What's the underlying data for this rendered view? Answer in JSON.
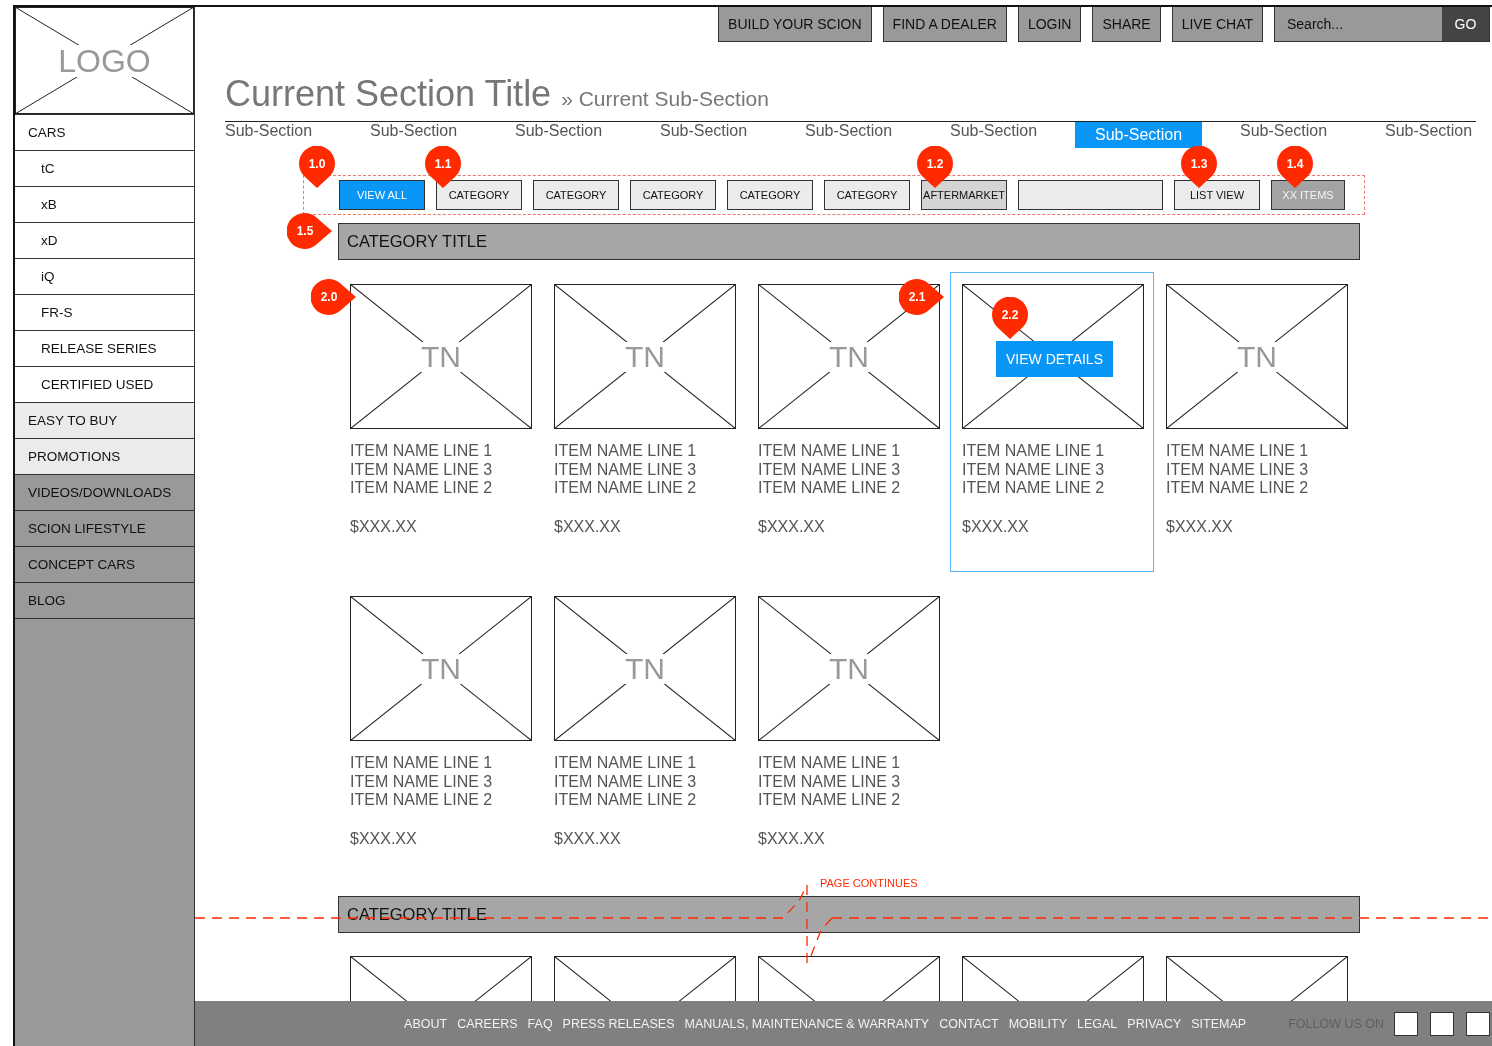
{
  "logo": {
    "text": "LOGO"
  },
  "sidebar": {
    "items": [
      {
        "label": "CARS",
        "kind": "header"
      },
      {
        "label": "tC",
        "kind": "sub"
      },
      {
        "label": "xB",
        "kind": "sub"
      },
      {
        "label": "xD",
        "kind": "sub"
      },
      {
        "label": "iQ",
        "kind": "sub"
      },
      {
        "label": "FR-S",
        "kind": "sub"
      },
      {
        "label": "RELEASE SERIES",
        "kind": "sub"
      },
      {
        "label": "CERTIFIED USED",
        "kind": "sub"
      },
      {
        "label": "EASY TO BUY",
        "kind": "light"
      },
      {
        "label": "PROMOTIONS",
        "kind": "light"
      },
      {
        "label": "VIDEOS/DOWNLOADS",
        "kind": "dark"
      },
      {
        "label": "SCION LIFESTYLE",
        "kind": "dark"
      },
      {
        "label": "CONCEPT CARS",
        "kind": "dark"
      },
      {
        "label": "BLOG",
        "kind": "dark"
      }
    ]
  },
  "top_nav": {
    "buttons": [
      "BUILD YOUR SCION",
      "FIND A DEALER",
      "LOGIN",
      "SHARE",
      "LIVE CHAT"
    ],
    "search": {
      "placeholder": "Search...",
      "button": "GO"
    }
  },
  "page_title": {
    "title": "Current Section Title",
    "subtitle": "» Current Sub-Section"
  },
  "subsection_tabs": [
    {
      "label": "Sub-Section",
      "selected": false
    },
    {
      "label": "Sub-Section",
      "selected": false
    },
    {
      "label": "Sub-Section",
      "selected": false
    },
    {
      "label": "Sub-Section",
      "selected": false
    },
    {
      "label": "Sub-Section",
      "selected": false
    },
    {
      "label": "Sub-Section",
      "selected": false
    },
    {
      "label": "Sub-Section",
      "selected": true
    },
    {
      "label": "Sub-Section",
      "selected": false
    },
    {
      "label": "Sub-Section",
      "selected": false
    }
  ],
  "filter_bar": {
    "items": [
      {
        "kind": "toggle",
        "label": "VIEW ALL",
        "selected": true
      },
      {
        "kind": "toggle",
        "label": "CATEGORY",
        "selected": false
      },
      {
        "kind": "toggle",
        "label": "CATEGORY",
        "selected": false
      },
      {
        "kind": "toggle",
        "label": "CATEGORY",
        "selected": false
      },
      {
        "kind": "toggle",
        "label": "CATEGORY",
        "selected": false
      },
      {
        "kind": "toggle",
        "label": "CATEGORY",
        "selected": false
      },
      {
        "kind": "featured",
        "label": "AFTERMARKET"
      },
      {
        "kind": "field"
      },
      {
        "kind": "button",
        "label": "LIST VIEW"
      },
      {
        "kind": "count",
        "label": "XX ITEMS"
      }
    ]
  },
  "category_title": "CATEGORY TITLE",
  "products": [
    {
      "thumbnail": "TN",
      "lines": [
        "ITEM NAME LINE 1",
        "ITEM NAME LINE 3",
        "ITEM NAME LINE 2"
      ],
      "price": "$XXX.XX",
      "hovered": false
    },
    {
      "thumbnail": "TN",
      "lines": [
        "ITEM NAME LINE 1",
        "ITEM NAME LINE 3",
        "ITEM NAME LINE 2"
      ],
      "price": "$XXX.XX",
      "hovered": false
    },
    {
      "thumbnail": "TN",
      "lines": [
        "ITEM NAME LINE 1",
        "ITEM NAME LINE 3",
        "ITEM NAME LINE 2"
      ],
      "price": "$XXX.XX",
      "hovered": false
    },
    {
      "lines": [
        "ITEM NAME LINE 1",
        "ITEM NAME LINE 3",
        "ITEM NAME LINE 2"
      ],
      "price": "$XXX.XX",
      "hovered": true,
      "action": "VIEW DETAILS"
    },
    {
      "thumbnail": "TN",
      "lines": [
        "ITEM NAME LINE 1",
        "ITEM NAME LINE 3",
        "ITEM NAME LINE 2"
      ],
      "price": "$XXX.XX",
      "hovered": false
    },
    {
      "thumbnail": "TN",
      "lines": [
        "ITEM NAME LINE 1",
        "ITEM NAME LINE 3",
        "ITEM NAME LINE 2"
      ],
      "price": "$XXX.XX",
      "hovered": false
    },
    {
      "thumbnail": "TN",
      "lines": [
        "ITEM NAME LINE 1",
        "ITEM NAME LINE 3",
        "ITEM NAME LINE 2"
      ],
      "price": "$XXX.XX",
      "hovered": false
    },
    {
      "thumbnail": "TN",
      "lines": [
        "ITEM NAME LINE 1",
        "ITEM NAME LINE 3",
        "ITEM NAME LINE 2"
      ],
      "price": "$XXX.XX",
      "hovered": false
    }
  ],
  "page_break": {
    "note": "PAGE CONTINUES"
  },
  "next_section": {
    "title": "CATEGORY TITLE",
    "thumbnails": [
      {
        "kind": "partial"
      },
      {
        "kind": "partial"
      },
      {
        "kind": "partial"
      },
      {
        "kind": "partial"
      },
      {
        "kind": "partial"
      }
    ]
  },
  "annotations": [
    {
      "label": "1.0"
    },
    {
      "label": "1.1"
    },
    {
      "label": "1.2"
    },
    {
      "label": "1.3"
    },
    {
      "label": "1.4"
    },
    {
      "label": "1.5"
    },
    {
      "label": "2.0"
    },
    {
      "label": "2.1"
    },
    {
      "label": "2.2"
    }
  ],
  "footer": {
    "links": [
      "ABOUT",
      "CAREERS",
      "FAQ",
      "PRESS RELEASES",
      "MANUALS, MAINTENANCE & WARRANTY",
      "CONTACT",
      "MOBILITY",
      "LEGAL",
      "PRIVACY",
      "SITEMAP"
    ],
    "follow_label": "FOLLOW US ON",
    "social": [
      {
        "kind": "square"
      },
      {
        "kind": "square"
      },
      {
        "kind": "square"
      }
    ]
  }
}
